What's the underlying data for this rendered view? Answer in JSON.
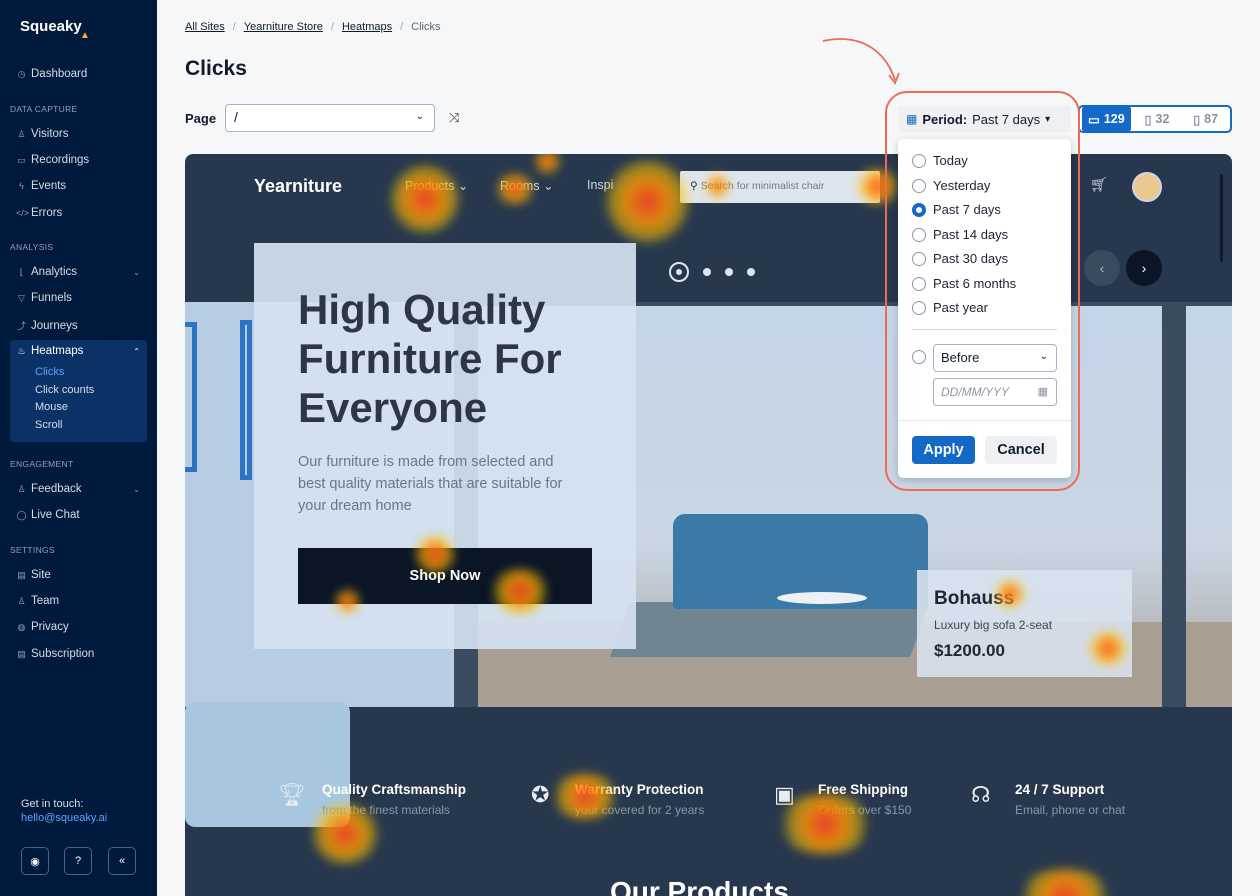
{
  "app": {
    "logo": "Squeaky"
  },
  "sidebar": {
    "top_items": [
      {
        "label": "Dashboard",
        "icon": "clock-icon"
      }
    ],
    "sections": [
      {
        "label": "DATA CAPTURE",
        "items": [
          "Visitors",
          "Recordings",
          "Events",
          "Errors"
        ]
      },
      {
        "label": "ANALYSIS",
        "items": [
          "Analytics",
          "Funnels",
          "Journeys",
          "Heatmaps"
        ]
      },
      {
        "label": "ENGAGEMENT",
        "items": [
          "Feedback",
          "Live Chat"
        ]
      },
      {
        "label": "SETTINGS",
        "items": [
          "Site",
          "Team",
          "Privacy",
          "Subscription"
        ]
      }
    ],
    "heatmaps_sub": [
      "Clicks",
      "Click counts",
      "Mouse",
      "Scroll"
    ],
    "contact_label": "Get in touch:",
    "contact_email": "hello@squeaky.ai"
  },
  "breadcrumb": [
    "All Sites",
    "Yearniture Store",
    "Heatmaps",
    "Clicks"
  ],
  "page": {
    "title": "Clicks",
    "page_label": "Page",
    "page_value": "/"
  },
  "period": {
    "label": "Period:",
    "value": "Past 7 days"
  },
  "devices": [
    {
      "name": "desktop",
      "count": "129"
    },
    {
      "name": "tablet",
      "count": "32"
    },
    {
      "name": "mobile",
      "count": "87"
    }
  ],
  "dropdown": {
    "options": [
      "Today",
      "Yesterday",
      "Past 7 days",
      "Past 14 days",
      "Past 30 days",
      "Past 6 months",
      "Past year"
    ],
    "selected": "Past 7 days",
    "before_value": "Before",
    "date_placeholder": "DD/MM/YYY",
    "apply": "Apply",
    "cancel": "Cancel"
  },
  "site": {
    "brand": "Yearniture",
    "nav": [
      "Products",
      "Rooms",
      "Inspi"
    ],
    "search_placeholder": "Search for minimalist chair",
    "hero_title": "High Quality Furniture For Everyone",
    "hero_text": "Our furniture is made from selected and best quality materials that are suitable for your dream home",
    "cta": "Shop Now",
    "product": {
      "name": "Bohauss",
      "desc": "Luxury big sofa 2-seat",
      "price": "$1200.00"
    },
    "features": [
      {
        "title": "Quality Craftsmanship",
        "sub": "from the finest materials",
        "icon": "trophy-icon"
      },
      {
        "title": "Warranty Protection",
        "sub": "your covered for 2 years",
        "icon": "badge-check-icon"
      },
      {
        "title": "Free Shipping",
        "sub": "Orders over $150",
        "icon": "box-icon"
      },
      {
        "title": "24 / 7 Support",
        "sub": "Email, phone or chat",
        "icon": "headset-icon"
      }
    ],
    "section_title": "Our Products"
  },
  "colors": {
    "accent": "#1469c7",
    "sidebar": "#001a3d",
    "highlight": "#ef6a55"
  }
}
